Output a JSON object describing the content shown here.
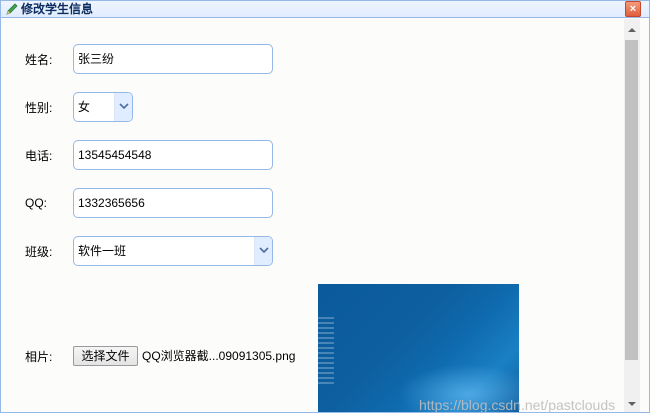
{
  "dialog": {
    "title": "修改学生信息",
    "close_label": "×"
  },
  "form": {
    "name_label": "姓名:",
    "name_value": "张三纷",
    "gender_label": "性别:",
    "gender_value": "女",
    "phone_label": "电话:",
    "phone_value": "13545454548",
    "qq_label": "QQ:",
    "qq_value": "1332365656",
    "class_label": "班级:",
    "class_value": "软件一班",
    "photo_label": "相片:",
    "file_button_label": "选择文件",
    "file_name": "QQ浏览器截...09091305.png"
  },
  "watermark": "https://blog.csdn.net/pastclouds",
  "icons": {
    "title": "edit-pencil-icon",
    "close": "close-icon",
    "dropdown": "chevron-down-icon",
    "scroll_up": "scroll-up-arrow-icon",
    "scroll_down": "scroll-down-arrow-icon"
  },
  "colors": {
    "border": "#95b8e7",
    "title_text": "#0e2d5f",
    "close": "#e0603b"
  }
}
